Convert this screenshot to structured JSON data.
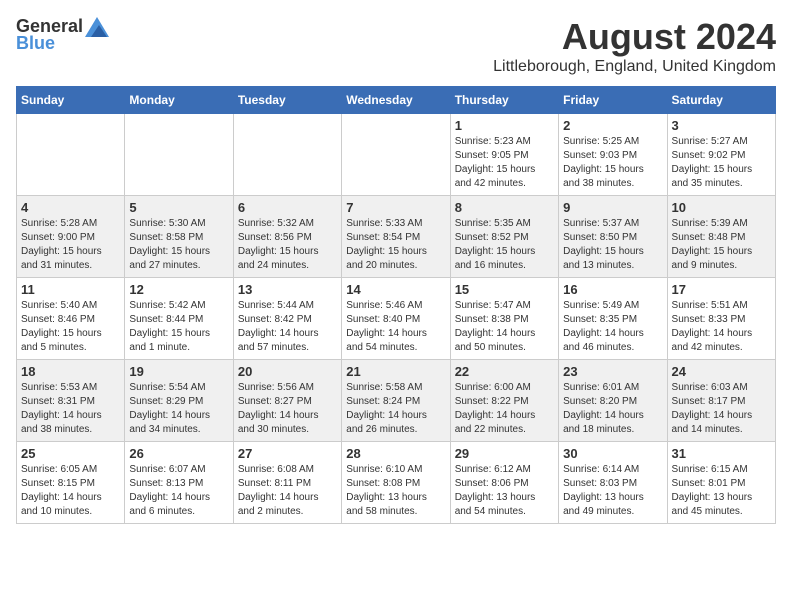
{
  "header": {
    "logo_general": "General",
    "logo_blue": "Blue",
    "title": "August 2024",
    "subtitle": "Littleborough, England, United Kingdom"
  },
  "calendar": {
    "days_of_week": [
      "Sunday",
      "Monday",
      "Tuesday",
      "Wednesday",
      "Thursday",
      "Friday",
      "Saturday"
    ],
    "weeks": [
      {
        "days": [
          {
            "number": "",
            "sunrise": "",
            "sunset": "",
            "daylight": ""
          },
          {
            "number": "",
            "sunrise": "",
            "sunset": "",
            "daylight": ""
          },
          {
            "number": "",
            "sunrise": "",
            "sunset": "",
            "daylight": ""
          },
          {
            "number": "",
            "sunrise": "",
            "sunset": "",
            "daylight": ""
          },
          {
            "number": "1",
            "sunrise": "Sunrise: 5:23 AM",
            "sunset": "Sunset: 9:05 PM",
            "daylight": "Daylight: 15 hours and 42 minutes."
          },
          {
            "number": "2",
            "sunrise": "Sunrise: 5:25 AM",
            "sunset": "Sunset: 9:03 PM",
            "daylight": "Daylight: 15 hours and 38 minutes."
          },
          {
            "number": "3",
            "sunrise": "Sunrise: 5:27 AM",
            "sunset": "Sunset: 9:02 PM",
            "daylight": "Daylight: 15 hours and 35 minutes."
          }
        ]
      },
      {
        "days": [
          {
            "number": "4",
            "sunrise": "Sunrise: 5:28 AM",
            "sunset": "Sunset: 9:00 PM",
            "daylight": "Daylight: 15 hours and 31 minutes."
          },
          {
            "number": "5",
            "sunrise": "Sunrise: 5:30 AM",
            "sunset": "Sunset: 8:58 PM",
            "daylight": "Daylight: 15 hours and 27 minutes."
          },
          {
            "number": "6",
            "sunrise": "Sunrise: 5:32 AM",
            "sunset": "Sunset: 8:56 PM",
            "daylight": "Daylight: 15 hours and 24 minutes."
          },
          {
            "number": "7",
            "sunrise": "Sunrise: 5:33 AM",
            "sunset": "Sunset: 8:54 PM",
            "daylight": "Daylight: 15 hours and 20 minutes."
          },
          {
            "number": "8",
            "sunrise": "Sunrise: 5:35 AM",
            "sunset": "Sunset: 8:52 PM",
            "daylight": "Daylight: 15 hours and 16 minutes."
          },
          {
            "number": "9",
            "sunrise": "Sunrise: 5:37 AM",
            "sunset": "Sunset: 8:50 PM",
            "daylight": "Daylight: 15 hours and 13 minutes."
          },
          {
            "number": "10",
            "sunrise": "Sunrise: 5:39 AM",
            "sunset": "Sunset: 8:48 PM",
            "daylight": "Daylight: 15 hours and 9 minutes."
          }
        ]
      },
      {
        "days": [
          {
            "number": "11",
            "sunrise": "Sunrise: 5:40 AM",
            "sunset": "Sunset: 8:46 PM",
            "daylight": "Daylight: 15 hours and 5 minutes."
          },
          {
            "number": "12",
            "sunrise": "Sunrise: 5:42 AM",
            "sunset": "Sunset: 8:44 PM",
            "daylight": "Daylight: 15 hours and 1 minute."
          },
          {
            "number": "13",
            "sunrise": "Sunrise: 5:44 AM",
            "sunset": "Sunset: 8:42 PM",
            "daylight": "Daylight: 14 hours and 57 minutes."
          },
          {
            "number": "14",
            "sunrise": "Sunrise: 5:46 AM",
            "sunset": "Sunset: 8:40 PM",
            "daylight": "Daylight: 14 hours and 54 minutes."
          },
          {
            "number": "15",
            "sunrise": "Sunrise: 5:47 AM",
            "sunset": "Sunset: 8:38 PM",
            "daylight": "Daylight: 14 hours and 50 minutes."
          },
          {
            "number": "16",
            "sunrise": "Sunrise: 5:49 AM",
            "sunset": "Sunset: 8:35 PM",
            "daylight": "Daylight: 14 hours and 46 minutes."
          },
          {
            "number": "17",
            "sunrise": "Sunrise: 5:51 AM",
            "sunset": "Sunset: 8:33 PM",
            "daylight": "Daylight: 14 hours and 42 minutes."
          }
        ]
      },
      {
        "days": [
          {
            "number": "18",
            "sunrise": "Sunrise: 5:53 AM",
            "sunset": "Sunset: 8:31 PM",
            "daylight": "Daylight: 14 hours and 38 minutes."
          },
          {
            "number": "19",
            "sunrise": "Sunrise: 5:54 AM",
            "sunset": "Sunset: 8:29 PM",
            "daylight": "Daylight: 14 hours and 34 minutes."
          },
          {
            "number": "20",
            "sunrise": "Sunrise: 5:56 AM",
            "sunset": "Sunset: 8:27 PM",
            "daylight": "Daylight: 14 hours and 30 minutes."
          },
          {
            "number": "21",
            "sunrise": "Sunrise: 5:58 AM",
            "sunset": "Sunset: 8:24 PM",
            "daylight": "Daylight: 14 hours and 26 minutes."
          },
          {
            "number": "22",
            "sunrise": "Sunrise: 6:00 AM",
            "sunset": "Sunset: 8:22 PM",
            "daylight": "Daylight: 14 hours and 22 minutes."
          },
          {
            "number": "23",
            "sunrise": "Sunrise: 6:01 AM",
            "sunset": "Sunset: 8:20 PM",
            "daylight": "Daylight: 14 hours and 18 minutes."
          },
          {
            "number": "24",
            "sunrise": "Sunrise: 6:03 AM",
            "sunset": "Sunset: 8:17 PM",
            "daylight": "Daylight: 14 hours and 14 minutes."
          }
        ]
      },
      {
        "days": [
          {
            "number": "25",
            "sunrise": "Sunrise: 6:05 AM",
            "sunset": "Sunset: 8:15 PM",
            "daylight": "Daylight: 14 hours and 10 minutes."
          },
          {
            "number": "26",
            "sunrise": "Sunrise: 6:07 AM",
            "sunset": "Sunset: 8:13 PM",
            "daylight": "Daylight: 14 hours and 6 minutes."
          },
          {
            "number": "27",
            "sunrise": "Sunrise: 6:08 AM",
            "sunset": "Sunset: 8:11 PM",
            "daylight": "Daylight: 14 hours and 2 minutes."
          },
          {
            "number": "28",
            "sunrise": "Sunrise: 6:10 AM",
            "sunset": "Sunset: 8:08 PM",
            "daylight": "Daylight: 13 hours and 58 minutes."
          },
          {
            "number": "29",
            "sunrise": "Sunrise: 6:12 AM",
            "sunset": "Sunset: 8:06 PM",
            "daylight": "Daylight: 13 hours and 54 minutes."
          },
          {
            "number": "30",
            "sunrise": "Sunrise: 6:14 AM",
            "sunset": "Sunset: 8:03 PM",
            "daylight": "Daylight: 13 hours and 49 minutes."
          },
          {
            "number": "31",
            "sunrise": "Sunrise: 6:15 AM",
            "sunset": "Sunset: 8:01 PM",
            "daylight": "Daylight: 13 hours and 45 minutes."
          }
        ]
      }
    ]
  }
}
